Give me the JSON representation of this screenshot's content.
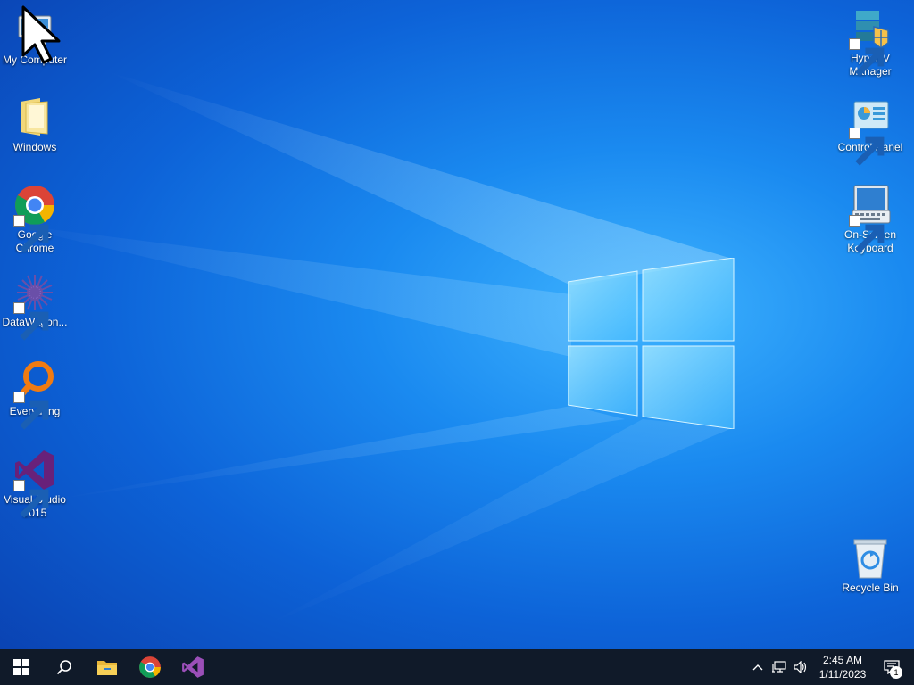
{
  "desktop": {
    "left_icons": [
      {
        "label": "My Computer",
        "icon": "computer-icon"
      },
      {
        "label": "Windows",
        "icon": "folder-icon"
      },
      {
        "label": "Google Chrome",
        "icon": "chrome-icon"
      },
      {
        "label": "DataWagon...",
        "icon": "datawagon-icon"
      },
      {
        "label": "Everything",
        "icon": "everything-search-icon"
      },
      {
        "label": "Visual Studio 2015",
        "icon": "visual-studio-icon"
      }
    ],
    "right_icons": [
      {
        "label": "Hyper-V Manager",
        "icon": "hyper-v-icon"
      },
      {
        "label": "Control Panel",
        "icon": "control-panel-icon"
      },
      {
        "label": "On-Screen Keyboard",
        "icon": "keyboard-icon"
      },
      {
        "label": "Recycle Bin",
        "icon": "recycle-bin-icon"
      }
    ]
  },
  "taskbar": {
    "pinned": [
      "start-icon",
      "search-icon",
      "file-explorer-icon",
      "chrome-icon",
      "visual-studio-icon"
    ],
    "clock_time": "2:45 AM",
    "clock_date": "1/11/2023",
    "notification_count": "1"
  },
  "colors": {
    "taskbar_bg": "#101a29",
    "vs_purple": "#68217a",
    "desktop_blue": "#0d63d8"
  }
}
